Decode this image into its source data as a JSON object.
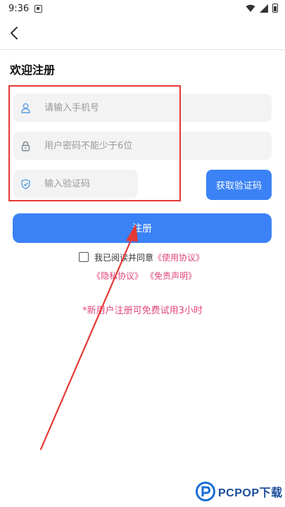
{
  "status_bar": {
    "time": "9:36"
  },
  "header": {
    "back_icon": "chevron-left-icon"
  },
  "page": {
    "title": "欢迎注册"
  },
  "form": {
    "phone": {
      "placeholder": "请输入手机号",
      "value": "",
      "icon": "user-icon"
    },
    "password": {
      "placeholder": "用户密码不能少于6位",
      "value": "",
      "icon": "lock-icon"
    },
    "code": {
      "placeholder": "输入验证码",
      "value": "",
      "icon": "shield-icon"
    },
    "get_code_label": "获取验证码",
    "register_label": "注册"
  },
  "agreement": {
    "checked": false,
    "prefix": "我已阅读并同意",
    "terms_link": "《使用协议》",
    "privacy_link": "《隐私协议》",
    "disclaimer_link": "《免责声明》"
  },
  "promo": {
    "text": "*新用户注册可免费试用3小时"
  },
  "colors": {
    "primary": "#3b82f6",
    "link": "#e0457e",
    "field_bg": "#f3f3f3",
    "annotation": "#e53935"
  },
  "watermark": {
    "text": "PCPOP下载"
  }
}
